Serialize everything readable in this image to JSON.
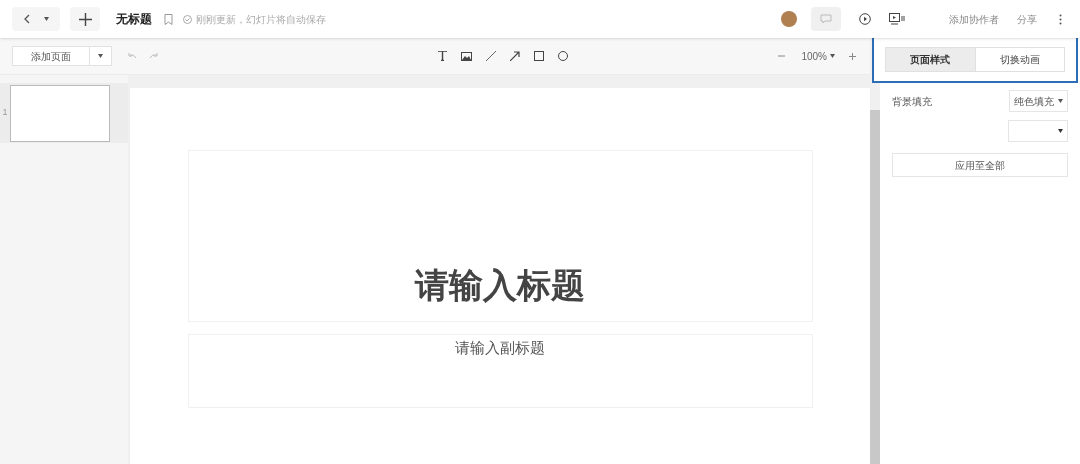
{
  "top_bar": {
    "title": "无标题",
    "save_status": "刚刚更新，幻灯片将自动保存",
    "buttons": [
      "添加协作者",
      "分享"
    ]
  },
  "toolbar": {
    "add_page": "添加页面",
    "zoom": "100%"
  },
  "thumbnails": [
    {
      "number": "1",
      "selected": true
    }
  ],
  "slide": {
    "title_placeholder": "请输入标题",
    "subtitle_placeholder": "请输入副标题"
  },
  "panel": {
    "tabs": [
      {
        "label": "页面样式",
        "selected": true
      },
      {
        "label": "切换动画",
        "selected": false
      }
    ],
    "background_label": "背景填充",
    "fill_type": "纯色填充",
    "apply_button": "应用至全部"
  }
}
